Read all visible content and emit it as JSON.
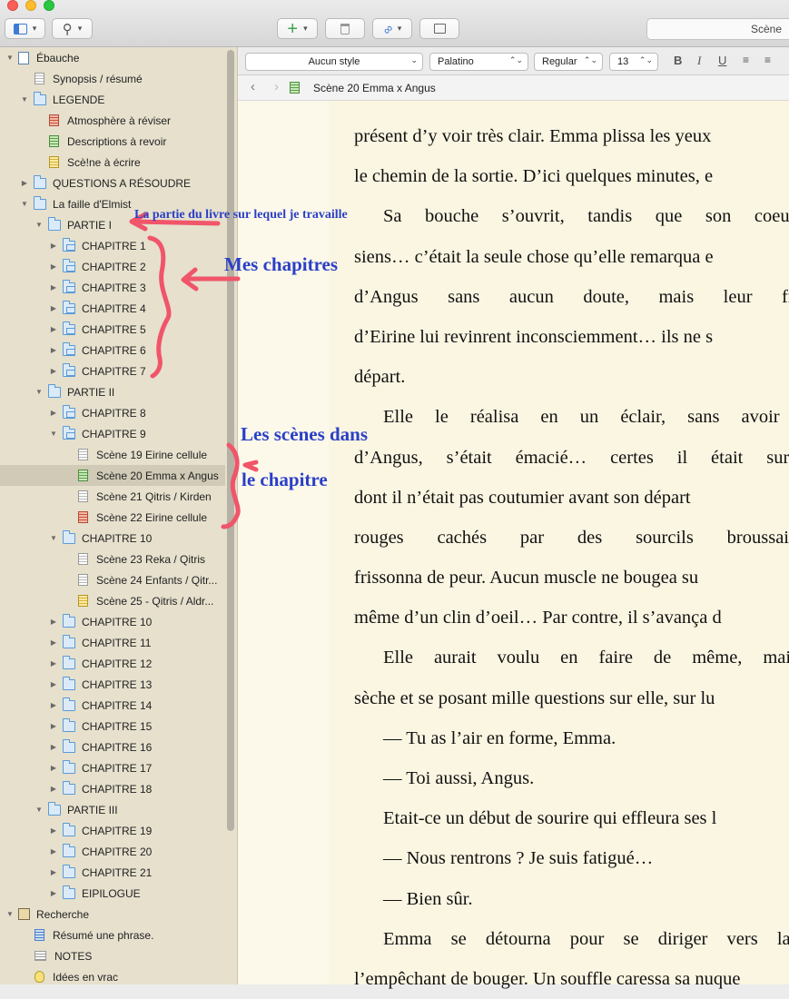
{
  "toolbar": {
    "search_text": "Scène"
  },
  "format_bar": {
    "style": "Aucun style",
    "font": "Palatino",
    "weight": "Regular",
    "size": "13",
    "bold": "B",
    "italic": "I",
    "underline": "U"
  },
  "header": {
    "document_title": "Scène 20 Emma x Angus"
  },
  "binder": [
    {
      "label": "Ébauche",
      "level": 0,
      "tri": "open",
      "icon": "draft"
    },
    {
      "label": "Synopsis / résumé",
      "level": 1,
      "tri": "none",
      "icon": "doc"
    },
    {
      "label": "LEGENDE",
      "level": 1,
      "tri": "open",
      "icon": "folder"
    },
    {
      "label": "Atmosphère à réviser",
      "level": 2,
      "tri": "none",
      "icon": "doc-red"
    },
    {
      "label": "Descriptions à revoir",
      "level": 2,
      "tri": "none",
      "icon": "doc-green"
    },
    {
      "label": "Scè!ne à écrire",
      "level": 2,
      "tri": "none",
      "icon": "doc-yellow"
    },
    {
      "label": "QUESTIONS A RÉSOUDRE",
      "level": 1,
      "tri": "closed",
      "icon": "folder"
    },
    {
      "label": "La faille d'Elmist",
      "level": 1,
      "tri": "open",
      "icon": "folder"
    },
    {
      "label": "PARTIE  I",
      "level": 2,
      "tri": "open",
      "icon": "folder"
    },
    {
      "label": "CHAPITRE 1",
      "level": 3,
      "tri": "closed",
      "icon": "folders"
    },
    {
      "label": "CHAPITRE 2",
      "level": 3,
      "tri": "closed",
      "icon": "folders"
    },
    {
      "label": "CHAPITRE 3",
      "level": 3,
      "tri": "closed",
      "icon": "folders"
    },
    {
      "label": "CHAPITRE 4",
      "level": 3,
      "tri": "closed",
      "icon": "folders"
    },
    {
      "label": "CHAPITRE 5",
      "level": 3,
      "tri": "closed",
      "icon": "folders"
    },
    {
      "label": "CHAPITRE 6",
      "level": 3,
      "tri": "closed",
      "icon": "folders"
    },
    {
      "label": "CHAPITRE 7",
      "level": 3,
      "tri": "closed",
      "icon": "folders"
    },
    {
      "label": "PARTIE  II",
      "level": 2,
      "tri": "open",
      "icon": "folder"
    },
    {
      "label": "CHAPITRE 8",
      "level": 3,
      "tri": "closed",
      "icon": "folders"
    },
    {
      "label": "CHAPITRE 9",
      "level": 3,
      "tri": "open",
      "icon": "folders"
    },
    {
      "label": "Scène 19 Eirine cellule",
      "level": 4,
      "tri": "none",
      "icon": "doc"
    },
    {
      "label": "Scène 20 Emma x Angus",
      "level": 4,
      "tri": "none",
      "icon": "doc-green",
      "selected": true
    },
    {
      "label": "Scène 21 Qitris / Kirden",
      "level": 4,
      "tri": "none",
      "icon": "doc"
    },
    {
      "label": "Scène 22 Eirine cellule",
      "level": 4,
      "tri": "none",
      "icon": "doc-red"
    },
    {
      "label": "CHAPITRE 10",
      "level": 3,
      "tri": "open",
      "icon": "folder"
    },
    {
      "label": "Scène 23 Reka / Qitris",
      "level": 4,
      "tri": "none",
      "icon": "doc"
    },
    {
      "label": "Scène 24 Enfants / Qitr...",
      "level": 4,
      "tri": "none",
      "icon": "doc"
    },
    {
      "label": "Scène 25 - Qitris / Aldr...",
      "level": 4,
      "tri": "none",
      "icon": "doc-yellow"
    },
    {
      "label": "CHAPITRE 10",
      "level": 3,
      "tri": "closed",
      "icon": "folder"
    },
    {
      "label": "CHAPITRE 11",
      "level": 3,
      "tri": "closed",
      "icon": "folder"
    },
    {
      "label": "CHAPITRE 12",
      "level": 3,
      "tri": "closed",
      "icon": "folder"
    },
    {
      "label": "CHAPITRE 13",
      "level": 3,
      "tri": "closed",
      "icon": "folder"
    },
    {
      "label": "CHAPITRE 14",
      "level": 3,
      "tri": "closed",
      "icon": "folder"
    },
    {
      "label": "CHAPITRE 15",
      "level": 3,
      "tri": "closed",
      "icon": "folder"
    },
    {
      "label": "CHAPITRE 16",
      "level": 3,
      "tri": "closed",
      "icon": "folder"
    },
    {
      "label": "CHAPITRE 17",
      "level": 3,
      "tri": "closed",
      "icon": "folder"
    },
    {
      "label": "CHAPITRE 18",
      "level": 3,
      "tri": "closed",
      "icon": "folder"
    },
    {
      "label": "PARTIE  III",
      "level": 2,
      "tri": "open",
      "icon": "folder"
    },
    {
      "label": "CHAPITRE 19",
      "level": 3,
      "tri": "closed",
      "icon": "folder"
    },
    {
      "label": "CHAPITRE 20",
      "level": 3,
      "tri": "closed",
      "icon": "folder"
    },
    {
      "label": "CHAPITRE 21",
      "level": 3,
      "tri": "closed",
      "icon": "folder"
    },
    {
      "label": "EIPILOGUE",
      "level": 3,
      "tri": "closed",
      "icon": "folder"
    },
    {
      "label": "Recherche",
      "level": 0,
      "tri": "open",
      "icon": "research"
    },
    {
      "label": "Résumé une phrase.",
      "level": 1,
      "tri": "none",
      "icon": "doc-blue"
    },
    {
      "label": "NOTES",
      "level": 1,
      "tri": "none",
      "icon": "notes"
    },
    {
      "label": "Idées en vrac",
      "level": 1,
      "tri": "none",
      "icon": "bulb"
    }
  ],
  "editor_lines": [
    {
      "text": "présent d’y voir très clair. Emma plissa les yeux",
      "indent": false,
      "justify": false
    },
    {
      "text": "le chemin de la sortie. D’ici quelques minutes, e",
      "indent": false,
      "justify": false
    },
    {
      "text": "Sa bouche s’ouvrit, tandis que son coeur s",
      "indent": true,
      "justify": true
    },
    {
      "text": "siens… c’était la seule chose qu’elle remarqua e",
      "indent": false,
      "justify": false
    },
    {
      "text": "d’Angus sans aucun doute, mais leur froide",
      "indent": false,
      "justify": true
    },
    {
      "text": "d’Eirine lui revinrent inconsciemment… ils ne s",
      "indent": false,
      "justify": false
    },
    {
      "text": "départ.",
      "indent": false,
      "justify": false
    },
    {
      "text": "Elle le réalisa en un éclair, sans avoir bes",
      "indent": true,
      "justify": true
    },
    {
      "text": "d’Angus, s’était émacié… certes il était sur le",
      "indent": false,
      "justify": true
    },
    {
      "text": "dont il n’était pas coutumier avant son départ",
      "indent": false,
      "justify": false
    },
    {
      "text": "rouges cachés par des sourcils broussailleux",
      "indent": false,
      "justify": true
    },
    {
      "text": "frissonna de peur. Aucun muscle ne bougea su",
      "indent": false,
      "justify": false
    },
    {
      "text": "même d’un clin d’oeil… Par contre, il s’avança d",
      "indent": false,
      "justify": false
    },
    {
      "text": "Elle aurait voulu en faire de même, mais s",
      "indent": true,
      "justify": true
    },
    {
      "text": "sèche et se posant mille questions sur elle, sur lu",
      "indent": false,
      "justify": false
    },
    {
      "text": "— Tu as l’air en forme, Emma.",
      "indent": true,
      "justify": false
    },
    {
      "text": "— Toi aussi, Angus.",
      "indent": true,
      "justify": false
    },
    {
      "text": "Etait-ce un début de sourire qui effleura ses l",
      "indent": true,
      "justify": false
    },
    {
      "text": "— Nous rentrons ? Je suis fatigué…",
      "indent": true,
      "justify": false
    },
    {
      "text": "— Bien sûr.",
      "indent": true,
      "justify": false
    },
    {
      "text": "Emma se détourna pour se diriger vers la so",
      "indent": true,
      "justify": true
    },
    {
      "text": "l’empêchant de bouger. Un souffle caressa sa nuque",
      "indent": false,
      "justify": false
    }
  ],
  "annotations": {
    "partie": "La partie du livre sur lequel je travaille",
    "chapitres": "Mes chapitres",
    "scenes_line1": "Les scènes dans",
    "scenes_line2": "le chapitre",
    "color": "#2a3fc7",
    "marker_color": "#f0556a"
  }
}
